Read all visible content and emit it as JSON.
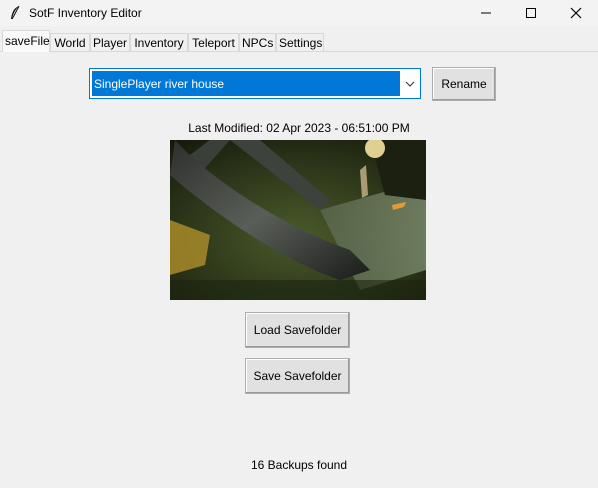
{
  "window": {
    "title": "SotF Inventory Editor"
  },
  "tabs": [
    "saveFile",
    "World",
    "Player",
    "Inventory",
    "Teleport",
    "NPCs",
    "Settings"
  ],
  "active_tab": "saveFile",
  "save_select": {
    "value": "SinglePlayer river house"
  },
  "buttons": {
    "rename": "Rename",
    "load": "Load Savefolder",
    "save": "Save Savefolder"
  },
  "last_modified": "Last Modified: 02 Apr 2023 - 06:51:00 PM",
  "backups": "16 Backups found",
  "colors": {
    "accent": "#0078d7",
    "background": "#f0f0f0"
  }
}
